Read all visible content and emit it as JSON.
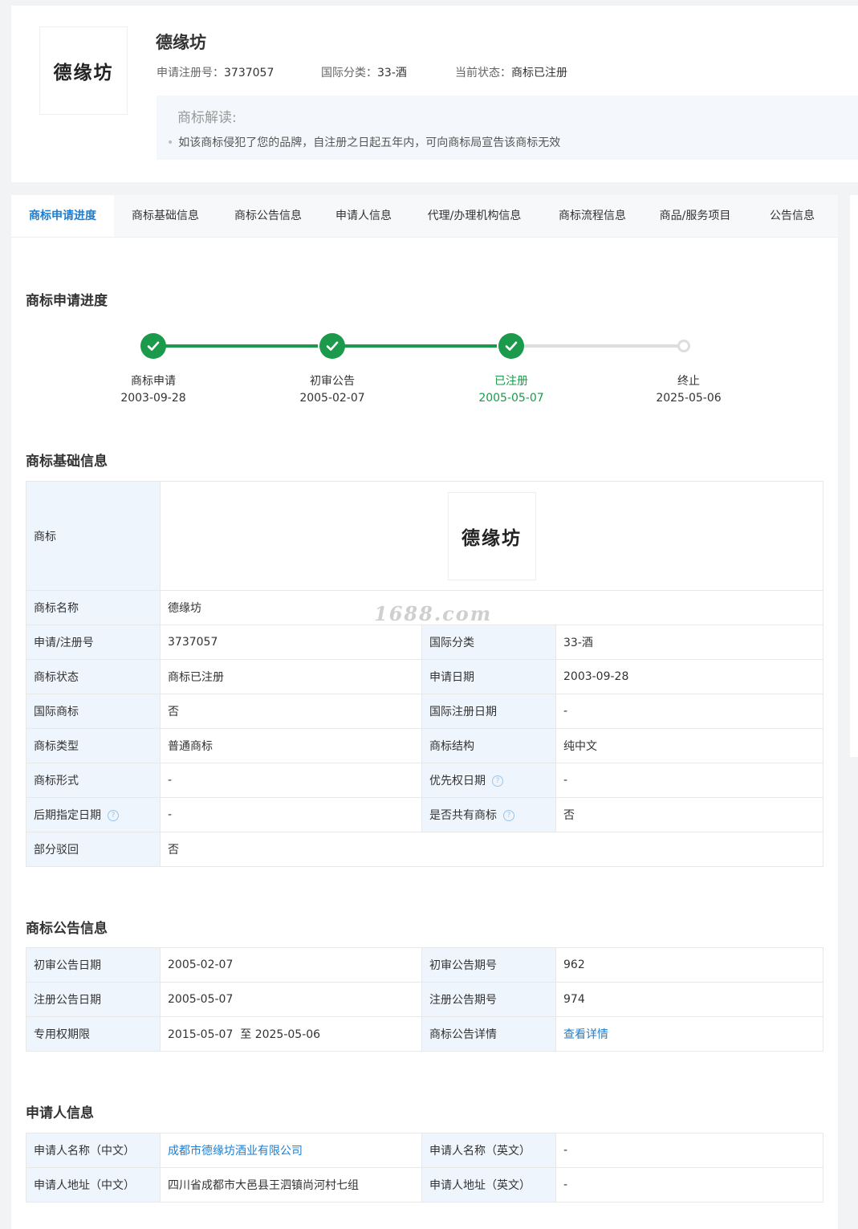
{
  "header": {
    "logo_text": "德缘坊",
    "title": "德缘坊",
    "reg_no_label": "申请注册号：",
    "reg_no": "3737057",
    "class_label": "国际分类：",
    "class_value": "33-酒",
    "status_label": "当前状态：",
    "status_value": "商标已注册",
    "reading_title": "商标解读:",
    "reading_item": "如该商标侵犯了您的品牌，自注册之日起五年内，可向商标局宣告该商标无效"
  },
  "tabs": [
    {
      "label": "商标申请进度"
    },
    {
      "label": "商标基础信息"
    },
    {
      "label": "商标公告信息"
    },
    {
      "label": "申请人信息"
    },
    {
      "label": "代理/办理机构信息"
    },
    {
      "label": "商标流程信息"
    },
    {
      "label": "商品/服务项目"
    },
    {
      "label": "公告信息"
    }
  ],
  "progress": {
    "title": "商标申请进度",
    "steps": [
      {
        "label": "商标申请",
        "date": "2003-09-28"
      },
      {
        "label": "初审公告",
        "date": "2005-02-07"
      },
      {
        "label": "已注册",
        "date": "2005-05-07"
      },
      {
        "label": "终止",
        "date": "2025-05-06"
      }
    ],
    "done_color": "#1a9a4a"
  },
  "basic": {
    "title": "商标基础信息",
    "logo_label": "商标",
    "logo_text": "德缘坊",
    "name_label": "商标名称",
    "name_value": "德缘坊",
    "rows": [
      [
        "申请/注册号",
        "3737057",
        "国际分类",
        "33-酒"
      ],
      [
        "商标状态",
        "商标已注册",
        "申请日期",
        "2003-09-28"
      ],
      [
        "国际商标",
        "否",
        "国际注册日期",
        "-"
      ],
      [
        "商标类型",
        "普通商标",
        "商标结构",
        "纯中文"
      ],
      [
        "商标形式",
        "-",
        "优先权日期",
        "-"
      ],
      [
        "后期指定日期",
        "-",
        "是否共有商标",
        "否"
      ]
    ],
    "partial_label": "部分驳回",
    "partial_value": "否",
    "help_glyph": "?"
  },
  "announce": {
    "title": "商标公告信息",
    "rows": [
      [
        "初审公告日期",
        "2005-02-07",
        "初审公告期号",
        "962"
      ],
      [
        "注册公告日期",
        "2005-05-07",
        "注册公告期号",
        "974"
      ],
      [
        "专用权期限",
        "2015-05-07  至 2025-05-06",
        "商标公告详情",
        "查看详情"
      ]
    ]
  },
  "applicant": {
    "title": "申请人信息",
    "rows": [
      [
        "申请人名称（中文）",
        "成都市德缘坊酒业有限公司",
        "申请人名称（英文）",
        "-"
      ],
      [
        "申请人地址（中文）",
        "四川省成都市大邑县王泗镇尚河村七组",
        "申请人地址（英文）",
        "-"
      ]
    ]
  },
  "watermark": "1688.com",
  "colors": {
    "accent": "#1a7fd4",
    "success": "#1a9a4a",
    "label_bg": "#eef5fc"
  }
}
